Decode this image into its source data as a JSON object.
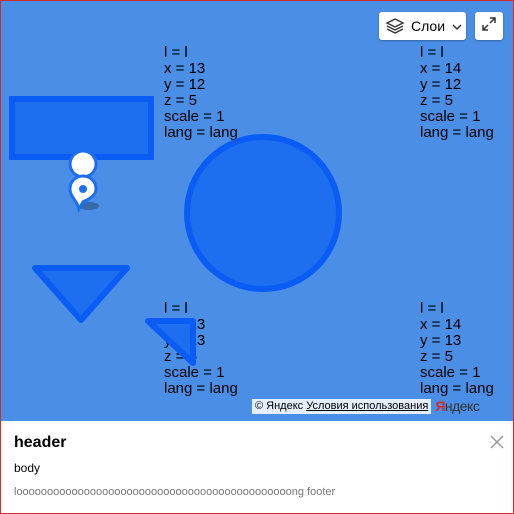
{
  "controls": {
    "layers_label": "Слои",
    "layers_icon": "layers-icon",
    "dropdown_icon": "chevron-down-icon",
    "fullscreen_icon": "expand-icon"
  },
  "tiles": {
    "top_left": [
      "l = l",
      "x = 13",
      "y = 12",
      "z = 5",
      "scale = 1",
      "lang = lang"
    ],
    "top_right": [
      "l = l",
      "x = 14",
      "y = 12",
      "z = 5",
      "scale = 1",
      "lang = lang"
    ],
    "bottom_left": [
      "l = l",
      "x = 13",
      "y = 13",
      "z = 5",
      "scale = 1",
      "lang = lang"
    ],
    "bottom_right": [
      "l = l",
      "x = 14",
      "y = 13",
      "z = 5",
      "scale = 1",
      "lang = lang"
    ]
  },
  "copyright": {
    "text": "© Яндекс",
    "terms_link": "Условия использования",
    "logo_first": "Я",
    "logo_rest": "ндекс"
  },
  "balloon": {
    "header": "header",
    "body": "body",
    "footer": "looooooooooooooooooooooooooooooooooooooooooooong footer",
    "close_icon": "close-icon"
  },
  "colors": {
    "map_background": "#4a8ee6",
    "geo_fill": "#1e6ff0",
    "geo_stroke": "#0a5cf5",
    "frame_border": "#d32a2a"
  }
}
